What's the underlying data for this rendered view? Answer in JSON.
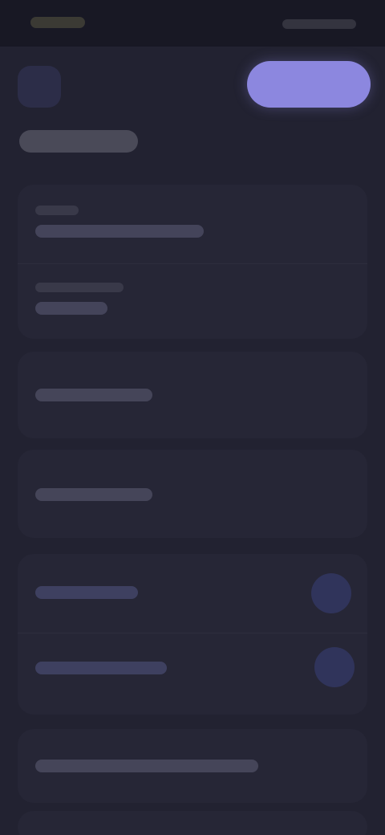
{
  "colors": {
    "background": "#222231",
    "status_bar": "#181824",
    "surface": "#262636",
    "accent": "#8c87df",
    "accent_muted": "#30345b",
    "text_placeholder": "#44445a"
  },
  "icons": {
    "back": "chevron-left-icon",
    "toggle": "toggle-icon"
  }
}
